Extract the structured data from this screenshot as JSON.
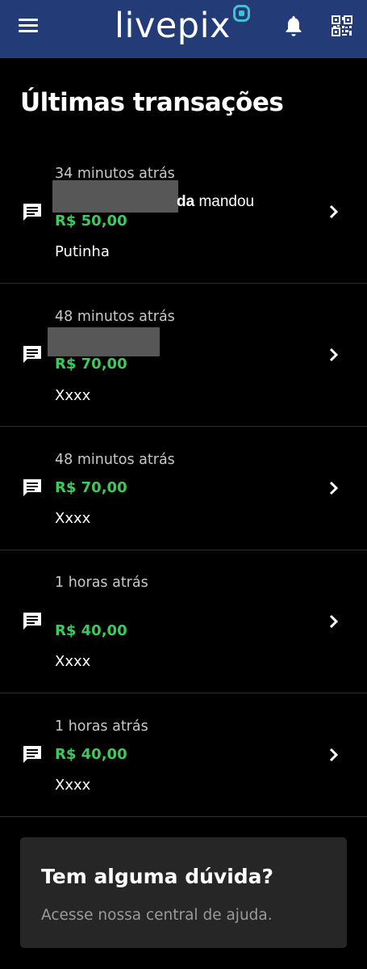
{
  "header": {
    "logo_text": "livepix",
    "icons": {
      "menu": "menu-icon",
      "logo_mark": "livepix-logo-icon",
      "notifications": "bell-icon",
      "qr": "qr-code-icon"
    },
    "background_color": "#233c78"
  },
  "page": {
    "title": "Últimas transações"
  },
  "transactions": [
    {
      "time": "34 minutos atrás",
      "sender_suffix": "da",
      "sender_action": " mandou",
      "amount": "R$ 50,00",
      "note": "Putinha"
    },
    {
      "time": "48 minutos atrás",
      "amount": "R$ 70,00",
      "note": "Xxxx"
    },
    {
      "time": "48 minutos atrás",
      "amount": "R$ 70,00",
      "note": "Xxxx"
    },
    {
      "time": "1 horas atrás",
      "amount": "R$ 40,00",
      "note": "Xxxx"
    },
    {
      "time": "1 horas atrás",
      "amount": "R$ 40,00",
      "note": "Xxxx"
    }
  ],
  "help": {
    "title": "Tem alguma dúvida?",
    "subtitle": "Acesse nossa central de ajuda."
  },
  "colors": {
    "accent_green": "#3ec95e",
    "card_bg": "#262626"
  }
}
